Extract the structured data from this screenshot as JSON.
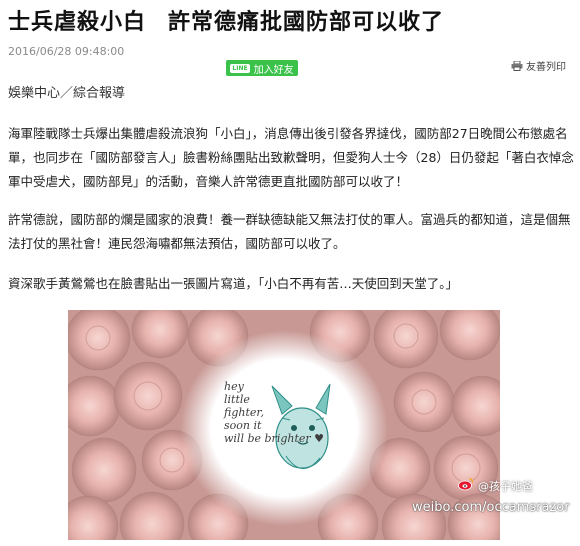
{
  "article": {
    "headline_part1": "士兵虐殺小白",
    "headline_part2": "許常德痛批國防部可以收了",
    "timestamp": "2016/06/28 09:48:00",
    "line_button_icon": "LINE",
    "line_button_label": "加入好友",
    "print_label": "友善列印",
    "source": "娛樂中心／綜合報導",
    "paragraph1": "海軍陸戰隊士兵爆出集體虐殺流浪狗「小白」，消息傳出後引發各界撻伐，國防部27日晚間公布懲處名單，也同步在「國防部發言人」臉書粉絲團貼出致歉聲明，但愛狗人士今（28）日仍發起「著白衣悼念軍中受虐犬，國防部見」的活動，音樂人許常德更直批國防部可以收了！",
    "paragraph2": "許常德說，國防部的爛是國家的浪費！養一群缺德缺能又無法打仗的軍人。富過兵的都知道，這是個無法打仗的黑社會！連民怨海嘯都無法預估，國防部可以收了。",
    "paragraph3": "資深歌手黃鶯鶯也在臉書貼出一張圖片寫道，「小白不再有苦…天使回到天堂了。」"
  },
  "image": {
    "handwritten_lines": [
      "hey",
      "little",
      "fighter,",
      "soon it",
      "will be brighter ♥"
    ],
    "watermark": "weibo.com/occamsrazor",
    "watermark_handle": "@孩子她爸"
  },
  "colors": {
    "line_green": "#3bc24a",
    "rose": "#e8b8b4",
    "dog_teal": "#3fa6a0"
  },
  "icons": {
    "line": "line-logo-icon",
    "print": "printer-icon",
    "weibo": "weibo-logo-icon"
  }
}
